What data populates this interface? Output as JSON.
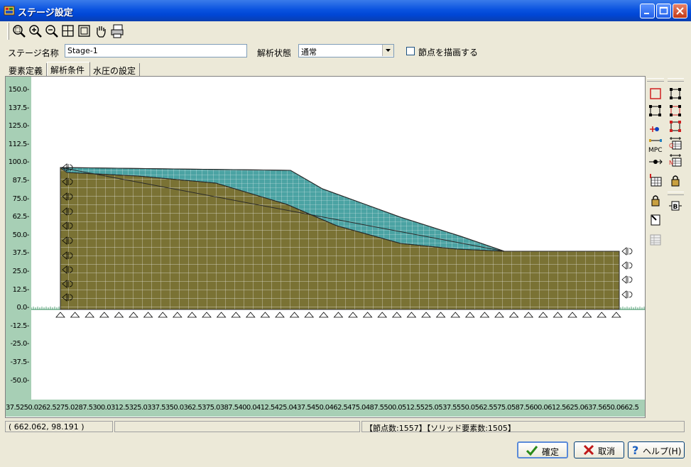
{
  "window": {
    "title": "ステージ設定",
    "controls": [
      "minimize",
      "maximize",
      "close"
    ]
  },
  "toolbar": {
    "buttons": [
      "zoom-window-icon",
      "zoom-in-icon",
      "zoom-out-icon",
      "fit-all-icon",
      "fit-view-icon",
      "pan-hand-icon",
      "print-icon"
    ]
  },
  "form": {
    "stage_name_label": "ステージ名称",
    "stage_name_value": "Stage-1",
    "analysis_state_label": "解析状態",
    "analysis_state_value": "通常",
    "draw_nodes_label": "節点を描画する",
    "draw_nodes_checked": false
  },
  "tabs": [
    {
      "label": "要素定義",
      "active": false
    },
    {
      "label": "解析条件",
      "active": true
    },
    {
      "label": "水圧の設定",
      "active": false
    }
  ],
  "plot": {
    "y_ticks": [
      "150.0",
      "137.5",
      "125.0",
      "112.5",
      "100.0",
      "87.5",
      "75.0",
      "62.5",
      "50.0",
      "37.5",
      "25.0",
      "12.5",
      "0.0",
      "-12.5",
      "-25.0",
      "-37.5",
      "-50.0"
    ],
    "x_tick_text": "37.5250.0262.5275.0287.5300.0312.5325.0337.5350.0362.5375.0387.5400.0412.5425.0437.5450.0462.5475.0487.5500.0512.5525.0537.5550.0562.5575.0587.5600.0612.5625.0637.5650.0662.5",
    "colors": {
      "axis_bg": "#a7cfb5",
      "soil": "#7a7234",
      "surface_layer": "#4ba3a3",
      "mesh": "#ffffff"
    }
  },
  "side_tools": {
    "column1": [
      "element-rect-icon",
      "element-select-icon",
      "node-constraint-icon",
      "mpc-icon",
      "spring-icon",
      "load-table-icon",
      "lock-icon",
      "edit-icon",
      "disabled-table-icon"
    ],
    "column2": [
      "rect-icon",
      "rect-select-icon",
      "rect-node-icon",
      "q-table-icon",
      "n-table-icon",
      "lock-icon",
      "b-button-icon"
    ],
    "mpc_label": "MPC"
  },
  "status": {
    "coords": "( 662.062,   98.191 )",
    "counts": "【節点数:1557】【ソリッド要素数:1505】"
  },
  "buttons": {
    "ok": "確定",
    "cancel": "取消",
    "help": "ヘルプ(H)"
  }
}
